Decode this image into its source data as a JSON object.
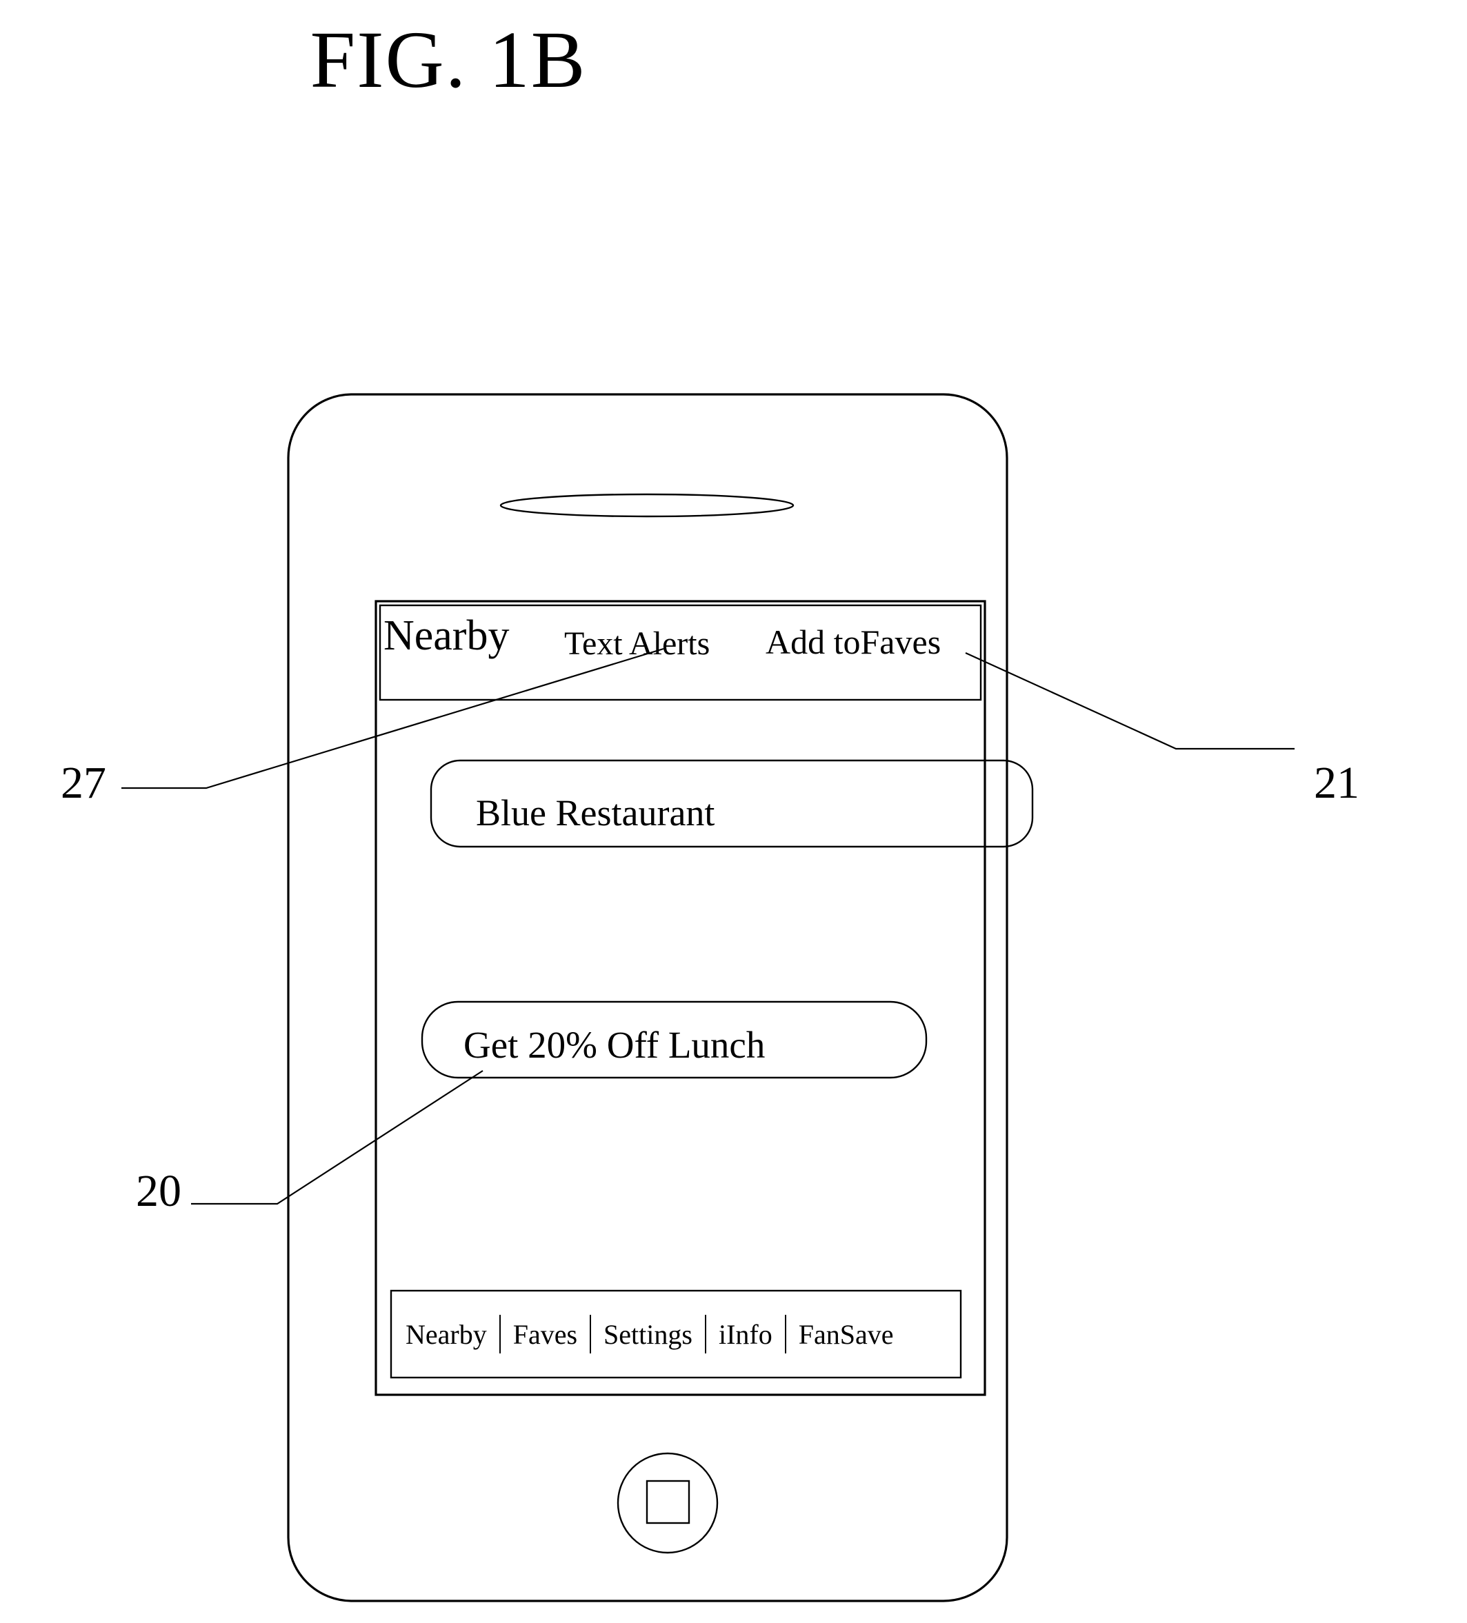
{
  "figure": {
    "title": "FIG. 1B",
    "type": "patent-drawing",
    "device": "smartphone-mockup"
  },
  "device": {
    "speaker_label": "earpiece-speaker",
    "home_button_label": "home-button"
  },
  "screen": {
    "header": {
      "title": "Nearby",
      "actions": [
        {
          "label": "Text Alerts"
        },
        {
          "label": "Add toFaves"
        }
      ]
    },
    "cards": [
      {
        "label": "Blue Restaurant"
      },
      {
        "label": "Get 20% Off Lunch"
      }
    ],
    "tabbar": {
      "items": [
        {
          "label": "Nearby"
        },
        {
          "label": "Faves"
        },
        {
          "label": "Settings"
        },
        {
          "label": "iInfo"
        },
        {
          "label": "FanSave"
        }
      ]
    }
  },
  "reference_numerals": [
    {
      "id": "27",
      "label": "27",
      "points_to": "header-text-alerts"
    },
    {
      "id": "21",
      "label": "21",
      "points_to": "header-add-to-faves"
    },
    {
      "id": "20",
      "label": "20",
      "points_to": "offer-card"
    }
  ],
  "colors": {
    "ink": "#000000",
    "paper": "#ffffff"
  }
}
